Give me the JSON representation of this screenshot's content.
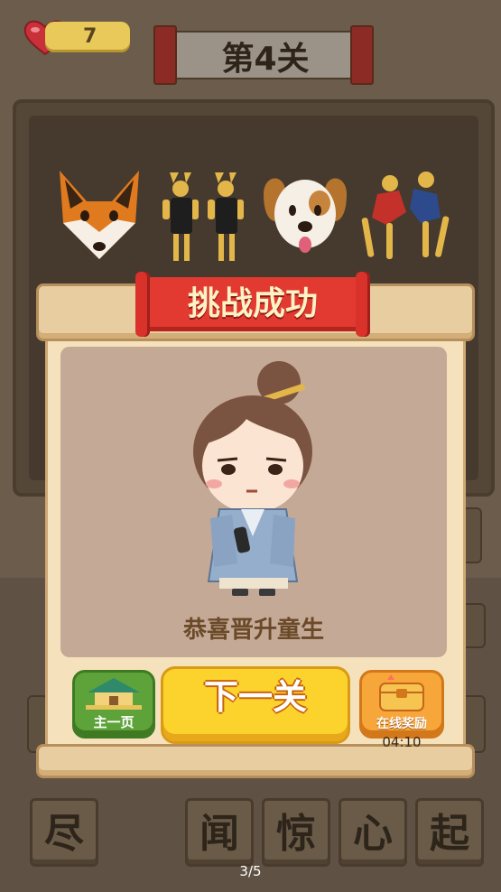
{
  "hud": {
    "lives": "7",
    "level_title": "第4关"
  },
  "puzzle": {
    "image_icons": [
      "fox-emoji-icon",
      "twin-bunny-dancers-icon",
      "puppy-emoji-icon",
      "wrestlers-icon"
    ]
  },
  "answer_tiles": [
    "尽",
    "闻",
    "惊",
    "心",
    "起"
  ],
  "dialog": {
    "title": "挑战成功",
    "rank_message": "恭喜晋升童生",
    "home_button": "主一页",
    "next_button": "下一关",
    "reward_button": "在线奖励",
    "reward_timer": "04:10"
  },
  "page_indicator": "3/5",
  "colors": {
    "title_red": "#e23a31",
    "next_yellow": "#fcd22d",
    "home_green": "#5ea33a",
    "reward_orange": "#f7a63a"
  }
}
